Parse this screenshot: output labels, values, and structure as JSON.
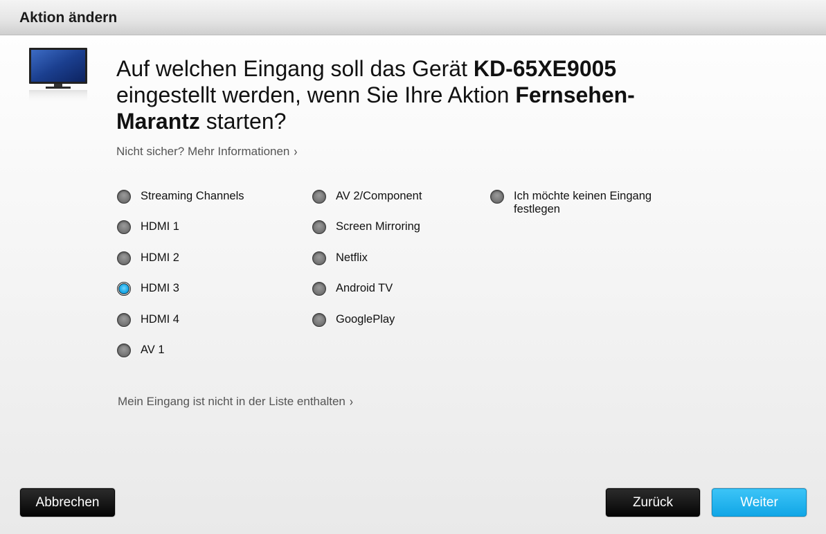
{
  "dialog": {
    "title": "Aktion ändern"
  },
  "question": {
    "part1": "Auf welchen Eingang soll das Gerät ",
    "device": "KD-65XE9005",
    "part2": " eingestellt werden, wenn Sie Ihre Aktion ",
    "activity": "Fernsehen-Marantz",
    "part3": " starten?"
  },
  "info_link": {
    "label": "Nicht sicher? Mehr Informationen"
  },
  "inputs": {
    "col1": [
      "Streaming Channels",
      "HDMI 1",
      "HDMI 2",
      "HDMI 3",
      "HDMI 4",
      "AV 1"
    ],
    "col2": [
      "AV 2/Component",
      "Screen Mirroring",
      "Netflix",
      "Android TV",
      "GooglePlay"
    ],
    "col3": [
      "Ich möchte keinen Eingang festlegen"
    ],
    "selected": "HDMI 3"
  },
  "not_listed_link": {
    "label": "Mein Eingang ist nicht in der Liste enthalten"
  },
  "buttons": {
    "cancel": "Abbrechen",
    "back": "Zurück",
    "next": "Weiter"
  },
  "colors": {
    "accent": "#1aa8e6",
    "dark_button": "#111111"
  }
}
